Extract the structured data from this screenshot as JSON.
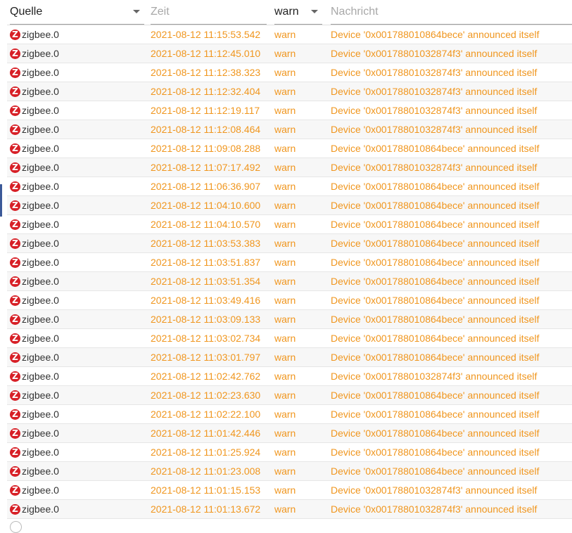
{
  "header": {
    "source_label": "Quelle",
    "time_placeholder": "Zeit",
    "level_label": "warn",
    "message_placeholder": "Nachricht"
  },
  "colors": {
    "warn": "#f0961e",
    "zigbee_icon": "#d71f26"
  },
  "rows": [
    {
      "source": "zigbee.0",
      "time": "2021-08-12 11:15:53.542",
      "level": "warn",
      "message": "Device '0x001788010864bece' announced itself"
    },
    {
      "source": "zigbee.0",
      "time": "2021-08-12 11:12:45.010",
      "level": "warn",
      "message": "Device '0x00178801032874f3' announced itself"
    },
    {
      "source": "zigbee.0",
      "time": "2021-08-12 11:12:38.323",
      "level": "warn",
      "message": "Device '0x00178801032874f3' announced itself"
    },
    {
      "source": "zigbee.0",
      "time": "2021-08-12 11:12:32.404",
      "level": "warn",
      "message": "Device '0x00178801032874f3' announced itself"
    },
    {
      "source": "zigbee.0",
      "time": "2021-08-12 11:12:19.117",
      "level": "warn",
      "message": "Device '0x00178801032874f3' announced itself"
    },
    {
      "source": "zigbee.0",
      "time": "2021-08-12 11:12:08.464",
      "level": "warn",
      "message": "Device '0x00178801032874f3' announced itself"
    },
    {
      "source": "zigbee.0",
      "time": "2021-08-12 11:09:08.288",
      "level": "warn",
      "message": "Device '0x001788010864bece' announced itself"
    },
    {
      "source": "zigbee.0",
      "time": "2021-08-12 11:07:17.492",
      "level": "warn",
      "message": "Device '0x00178801032874f3' announced itself"
    },
    {
      "source": "zigbee.0",
      "time": "2021-08-12 11:06:36.907",
      "level": "warn",
      "message": "Device '0x001788010864bece' announced itself"
    },
    {
      "source": "zigbee.0",
      "time": "2021-08-12 11:04:10.600",
      "level": "warn",
      "message": "Device '0x001788010864bece' announced itself"
    },
    {
      "source": "zigbee.0",
      "time": "2021-08-12 11:04:10.570",
      "level": "warn",
      "message": "Device '0x001788010864bece' announced itself"
    },
    {
      "source": "zigbee.0",
      "time": "2021-08-12 11:03:53.383",
      "level": "warn",
      "message": "Device '0x001788010864bece' announced itself"
    },
    {
      "source": "zigbee.0",
      "time": "2021-08-12 11:03:51.837",
      "level": "warn",
      "message": "Device '0x001788010864bece' announced itself"
    },
    {
      "source": "zigbee.0",
      "time": "2021-08-12 11:03:51.354",
      "level": "warn",
      "message": "Device '0x001788010864bece' announced itself"
    },
    {
      "source": "zigbee.0",
      "time": "2021-08-12 11:03:49.416",
      "level": "warn",
      "message": "Device '0x001788010864bece' announced itself"
    },
    {
      "source": "zigbee.0",
      "time": "2021-08-12 11:03:09.133",
      "level": "warn",
      "message": "Device '0x001788010864bece' announced itself"
    },
    {
      "source": "zigbee.0",
      "time": "2021-08-12 11:03:02.734",
      "level": "warn",
      "message": "Device '0x001788010864bece' announced itself"
    },
    {
      "source": "zigbee.0",
      "time": "2021-08-12 11:03:01.797",
      "level": "warn",
      "message": "Device '0x001788010864bece' announced itself"
    },
    {
      "source": "zigbee.0",
      "time": "2021-08-12 11:02:42.762",
      "level": "warn",
      "message": "Device '0x00178801032874f3' announced itself"
    },
    {
      "source": "zigbee.0",
      "time": "2021-08-12 11:02:23.630",
      "level": "warn",
      "message": "Device '0x001788010864bece' announced itself"
    },
    {
      "source": "zigbee.0",
      "time": "2021-08-12 11:02:22.100",
      "level": "warn",
      "message": "Device '0x001788010864bece' announced itself"
    },
    {
      "source": "zigbee.0",
      "time": "2021-08-12 11:01:42.446",
      "level": "warn",
      "message": "Device '0x001788010864bece' announced itself"
    },
    {
      "source": "zigbee.0",
      "time": "2021-08-12 11:01:25.924",
      "level": "warn",
      "message": "Device '0x001788010864bece' announced itself"
    },
    {
      "source": "zigbee.0",
      "time": "2021-08-12 11:01:23.008",
      "level": "warn",
      "message": "Device '0x001788010864bece' announced itself"
    },
    {
      "source": "zigbee.0",
      "time": "2021-08-12 11:01:15.153",
      "level": "warn",
      "message": "Device '0x00178801032874f3' announced itself"
    },
    {
      "source": "zigbee.0",
      "time": "2021-08-12 11:01:13.672",
      "level": "warn",
      "message": "Device '0x00178801032874f3' announced itself"
    }
  ]
}
